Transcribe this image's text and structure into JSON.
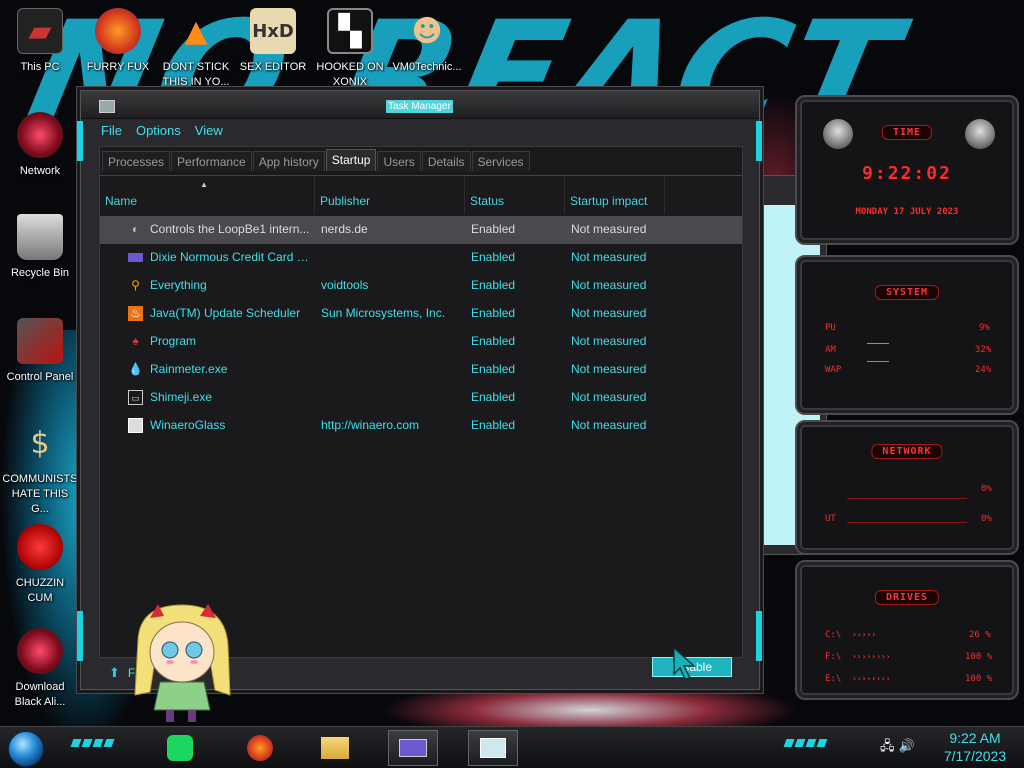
{
  "desktop": {
    "icons": [
      {
        "label": "This PC"
      },
      {
        "label": "FURRY FUX"
      },
      {
        "label": "DONT STICK THIS IN YO..."
      },
      {
        "label": "SEX EDITOR"
      },
      {
        "label": "HOOKED ON XONIX"
      },
      {
        "label": "VM0Technic..."
      },
      {
        "label": "Network"
      },
      {
        "label": "Recycle Bin"
      },
      {
        "label": "Control Panel"
      },
      {
        "label": "COMMUNISTS HATE THIS G..."
      },
      {
        "label": "CHUZZIN CUM"
      },
      {
        "label": "Download Black Ali..."
      }
    ]
  },
  "task_manager": {
    "title": "Task Manager",
    "menu": [
      "File",
      "Options",
      "View"
    ],
    "tabs": [
      "Processes",
      "Performance",
      "App history",
      "Startup",
      "Users",
      "Details",
      "Services"
    ],
    "active_tab": "Startup",
    "columns": [
      "Name",
      "Publisher",
      "Status",
      "Startup impact"
    ],
    "rows": [
      {
        "name": "Controls the LoopBe1 intern...",
        "publisher": "nerds.de",
        "status": "Enabled",
        "impact": "Not measured",
        "icon": "loopbe-icon"
      },
      {
        "name": "Dixie Normous Credit Card S...",
        "publisher": "",
        "status": "Enabled",
        "impact": "Not measured",
        "icon": "credit-card-icon"
      },
      {
        "name": "Everything",
        "publisher": "voidtools",
        "status": "Enabled",
        "impact": "Not measured",
        "icon": "magnifier-icon"
      },
      {
        "name": "Java(TM) Update Scheduler",
        "publisher": "Sun Microsystems, Inc.",
        "status": "Enabled",
        "impact": "Not measured",
        "icon": "java-icon"
      },
      {
        "name": "Program",
        "publisher": "",
        "status": "Enabled",
        "impact": "Not measured",
        "icon": "program-icon"
      },
      {
        "name": "Rainmeter.exe",
        "publisher": "",
        "status": "Enabled",
        "impact": "Not measured",
        "icon": "droplet-icon"
      },
      {
        "name": "Shimeji.exe",
        "publisher": "",
        "status": "Enabled",
        "impact": "Not measured",
        "icon": "shimeji-icon"
      },
      {
        "name": "WinaeroGlass",
        "publisher": "http://winaero.com",
        "status": "Enabled",
        "impact": "Not measured",
        "icon": "window-icon"
      }
    ],
    "fewer_details": "F",
    "disable_button": "Disable"
  },
  "widgets": {
    "time": {
      "title": "TIME",
      "clock": "9:22:02",
      "date": "MONDAY 17 JULY 2023"
    },
    "system": {
      "title": "SYSTEM",
      "rows": [
        {
          "label": "PU",
          "value": "9%"
        },
        {
          "label": "AM",
          "value": "32%"
        },
        {
          "label": "WAP",
          "value": "24%"
        }
      ]
    },
    "network": {
      "title": "NETWORK",
      "rows": [
        {
          "label": "",
          "value": "0%"
        },
        {
          "label": "UT",
          "value": "0%"
        }
      ]
    },
    "drives": {
      "title": "DRIVES",
      "rows": [
        {
          "label": "C:\\",
          "value": "26 %"
        },
        {
          "label": "F:\\",
          "value": "100 %"
        },
        {
          "label": "E:\\",
          "value": "100 %"
        }
      ]
    }
  },
  "taskbar": {
    "time": "9:22 AM",
    "date": "7/17/2023"
  },
  "colors": {
    "accent_cyan": "#3fe0ea",
    "widget_red": "#ff2a2a",
    "selected_row": "#4a4a4e"
  }
}
